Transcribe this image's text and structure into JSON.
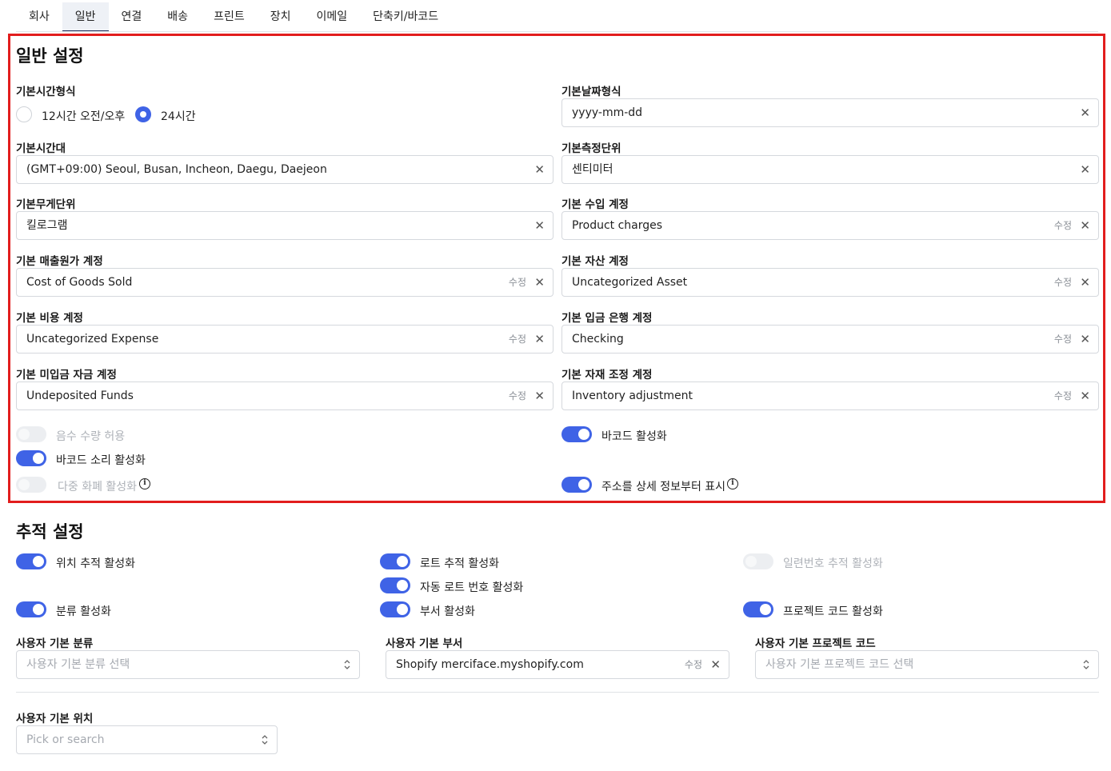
{
  "tabs": [
    "회사",
    "일반",
    "연결",
    "배송",
    "프린트",
    "장치",
    "이메일",
    "단축키/바코드"
  ],
  "general": {
    "title": "일반 설정",
    "time_format": {
      "label": "기본시간형식",
      "options": [
        "12시간 오전/오후",
        "24시간"
      ],
      "selected": "24시간"
    },
    "date_format": {
      "label": "기본날짜형식",
      "value": "yyyy-mm-dd"
    },
    "timezone": {
      "label": "기본시간대",
      "value": "(GMT+09:00) Seoul, Busan, Incheon, Daegu, Daejeon"
    },
    "measure_unit": {
      "label": "기본측정단위",
      "value": "센티미터"
    },
    "weight_unit": {
      "label": "기본무게단위",
      "value": "킬로그램"
    },
    "income_account": {
      "label": "기본 수입 계정",
      "value": "Product charges"
    },
    "cogs_account": {
      "label": "기본 매출원가 계정",
      "value": "Cost of Goods Sold"
    },
    "asset_account": {
      "label": "기본 자산 계정",
      "value": "Uncategorized Asset"
    },
    "expense_account": {
      "label": "기본 비용 계정",
      "value": "Uncategorized Expense"
    },
    "deposit_bank_account": {
      "label": "기본 입금 은행 계정",
      "value": "Checking"
    },
    "undeposited_account": {
      "label": "기본 미입금 자금 계정",
      "value": "Undeposited Funds"
    },
    "inventory_adj_account": {
      "label": "기본 자재 조정 계정",
      "value": "Inventory adjustment"
    },
    "edit_label": "수정",
    "toggles": {
      "negative_qty": {
        "label": "음수 수량 허용",
        "on": false,
        "disabled": true
      },
      "barcode_enable": {
        "label": "바코드 활성화",
        "on": true
      },
      "barcode_sound": {
        "label": "바코드 소리 활성화",
        "on": true
      },
      "multi_currency": {
        "label": "다중 화폐 활성화",
        "on": false,
        "disabled": true
      },
      "address_from_detail": {
        "label": "주소를 상세 정보부터 표시",
        "on": true
      }
    }
  },
  "tracking": {
    "title": "추적 설정",
    "toggles": {
      "location": {
        "label": "위치 추적 활성화",
        "on": true
      },
      "lot": {
        "label": "로트 추적 활성화",
        "on": true
      },
      "serial": {
        "label": "일련번호 추적 활성화",
        "on": false,
        "disabled": true
      },
      "auto_lot": {
        "label": "자동 로트 번호 활성화",
        "on": true
      },
      "category": {
        "label": "분류 활성화",
        "on": true
      },
      "department": {
        "label": "부서 활성화",
        "on": true
      },
      "project_code": {
        "label": "프로젝트 코드 활성화",
        "on": true
      }
    },
    "user_category": {
      "label": "사용자 기본 분류",
      "placeholder": "사용자 기본 분류 선택"
    },
    "user_department": {
      "label": "사용자 기본 부서",
      "value": "Shopify merciface.myshopify.com"
    },
    "user_project_code": {
      "label": "사용자 기본 프로젝트 코드",
      "placeholder": "사용자 기본 프로젝트 코드 선택"
    },
    "user_location": {
      "label": "사용자 기본 위치",
      "placeholder": "Pick or search"
    }
  },
  "colors": {
    "accent": "#3f63e6",
    "highlight_border": "#e21d1d",
    "active_tab_bg": "#eef1f6"
  },
  "icons": {
    "clear": "close-icon",
    "select": "chevron-updown-icon",
    "info": "info-icon"
  }
}
